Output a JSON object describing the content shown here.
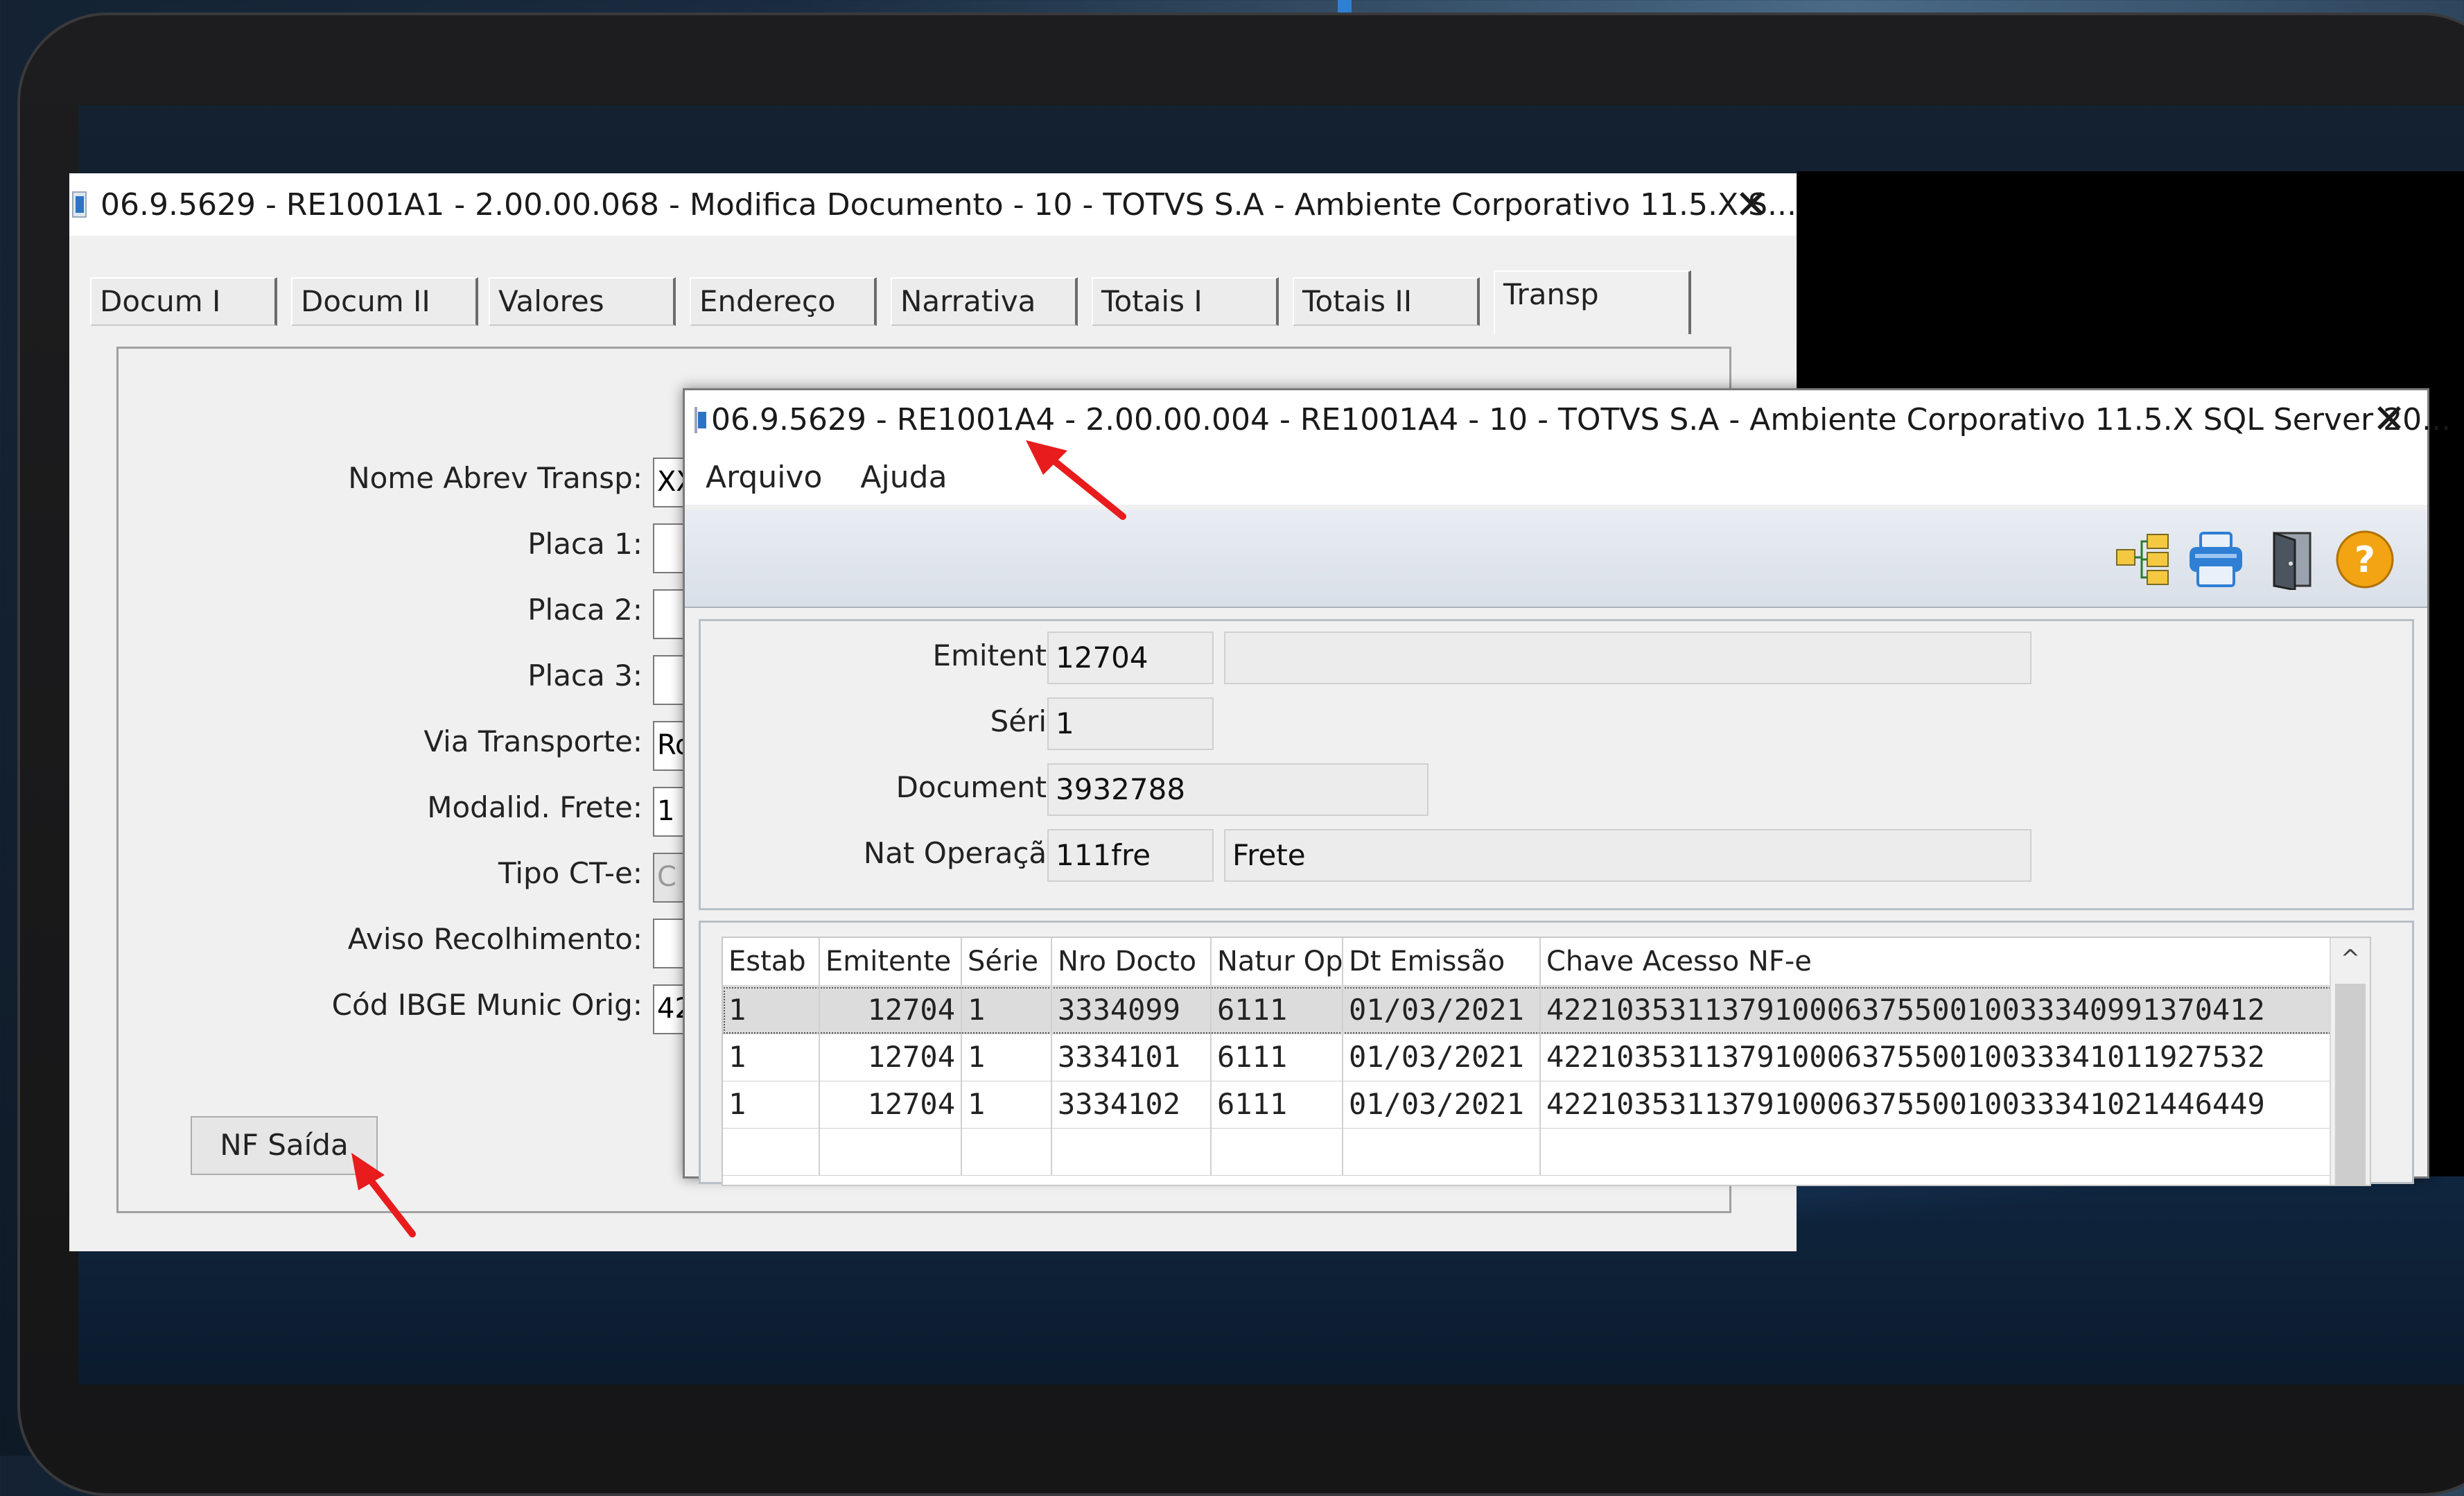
{
  "window_main": {
    "title": "06.9.5629 - RE1001A1 - 2.00.00.068 - Modifica Documento - 10 - TOTVS S.A - Ambiente Corporativo 11.5.X S...",
    "close_glyph": "✕",
    "tabs": [
      {
        "label": "Docum I"
      },
      {
        "label": "Docum II"
      },
      {
        "label": "Valores"
      },
      {
        "label": "Endereço"
      },
      {
        "label": "Narrativa"
      },
      {
        "label": "Totais I"
      },
      {
        "label": "Totais II"
      },
      {
        "label": "Transp"
      }
    ],
    "fields": [
      {
        "label": "Nome Abrev Transp:",
        "value": "XX"
      },
      {
        "label": "Placa 1:",
        "value": ""
      },
      {
        "label": "Placa 2:",
        "value": ""
      },
      {
        "label": "Placa 3:",
        "value": ""
      },
      {
        "label": "Via Transporte:",
        "value": "Ro"
      },
      {
        "label": "Modalid. Frete:",
        "value": "1"
      },
      {
        "label": "Tipo CT-e:",
        "value": "C"
      },
      {
        "label": "Aviso Recolhimento:",
        "value": ""
      },
      {
        "label": "Cód IBGE Munic Orig:",
        "value": "42"
      }
    ],
    "nf_button": "NF Saída"
  },
  "window_dialog": {
    "title": "06.9.5629 - RE1001A4 - 2.00.00.004 - RE1001A4 - 10 - TOTVS S.A - Ambiente Corporativo 11.5.X SQL Server 20...",
    "close_glyph": "✕",
    "menu": [
      "Arquivo",
      "Ajuda"
    ],
    "toolbar_icons": [
      "tree-view-icon",
      "print-icon",
      "exit-door-icon",
      "help-icon"
    ],
    "help_glyph": "?",
    "form": {
      "emitente_label": "Emitente:",
      "emitente_value": "12704",
      "emitente_desc": "",
      "serie_label": "Série:",
      "serie_value": "1",
      "documento_label": "Documento:",
      "documento_value": "3932788",
      "nat_label": "Nat Operação:",
      "nat_value": "111fre",
      "nat_desc": "Frete"
    },
    "grid": {
      "columns": [
        "Estab",
        "Emitente",
        "Série",
        "Nro Docto",
        "Natur Op",
        "Dt Emissão",
        "Chave Acesso NF-e"
      ],
      "rows": [
        [
          "1",
          "12704",
          "1",
          "3334099",
          "6111",
          "01/03/2021",
          "42210353113791000637550010033340991370412"
        ],
        [
          "1",
          "12704",
          "1",
          "3334101",
          "6111",
          "01/03/2021",
          "42210353113791000637550010033341011927532"
        ],
        [
          "1",
          "12704",
          "1",
          "3334102",
          "6111",
          "01/03/2021",
          "42210353113791000637550010033341021446449"
        ]
      ],
      "scroll_up_glyph": "^"
    }
  },
  "colors": {
    "annotation_arrow": "#e81c1c",
    "help_orange": "#f2a413",
    "print_blue": "#2f7fd4"
  }
}
